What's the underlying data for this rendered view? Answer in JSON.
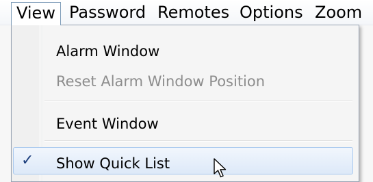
{
  "menubar": {
    "items": [
      {
        "label": "View",
        "open": true
      },
      {
        "label": "Password"
      },
      {
        "label": "Remotes"
      },
      {
        "label": "Options"
      },
      {
        "label": "Zoom"
      }
    ]
  },
  "dropdown": {
    "items": [
      {
        "label": "Alarm Window",
        "enabled": true
      },
      {
        "label": "Reset Alarm Window Position",
        "enabled": false
      },
      {
        "label": "Event Window",
        "enabled": true
      },
      {
        "label": "Show Quick List",
        "enabled": true,
        "checked": true,
        "highlighted": true
      }
    ],
    "check_glyph": "✓"
  },
  "colors": {
    "highlight_border": "#a8c8ee",
    "highlight_fill": "#dde9f8",
    "disabled_text": "#8d8d8d",
    "check": "#1d3f7d"
  },
  "icons": {
    "cursor": "arrow-cursor-icon",
    "check": "checkmark-icon"
  }
}
